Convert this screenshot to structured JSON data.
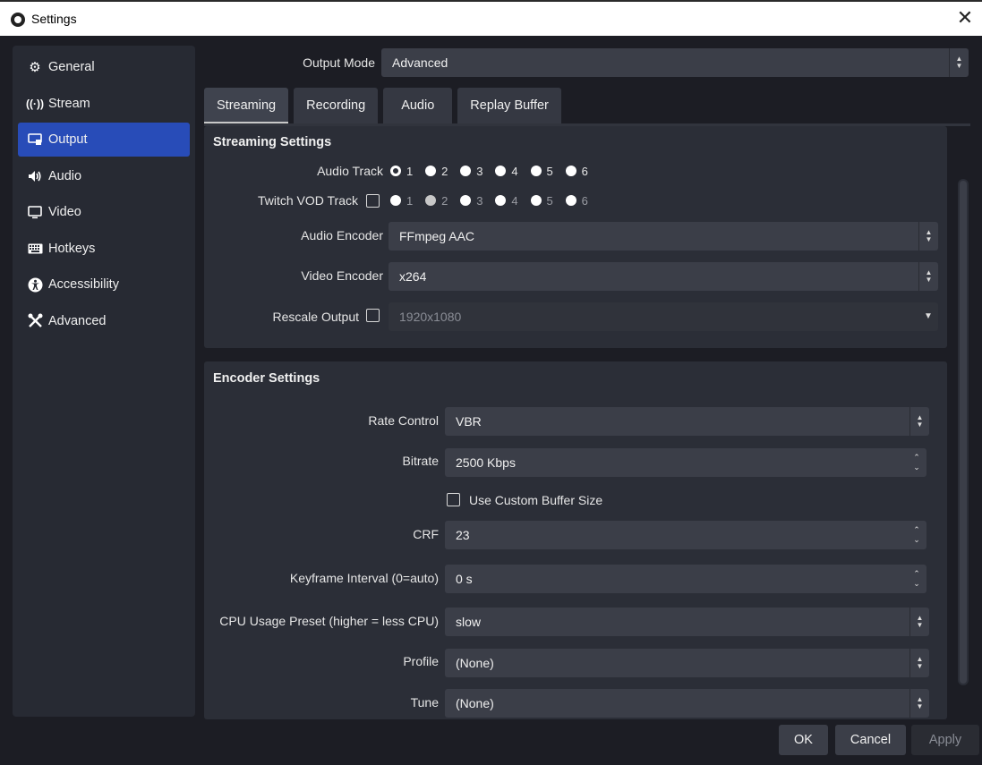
{
  "window": {
    "title": "Settings",
    "close": "✕"
  },
  "sidebar": {
    "items": [
      {
        "label": "General",
        "icon": "gear-icon",
        "glyph": "⚙"
      },
      {
        "label": "Stream",
        "icon": "antenna-icon",
        "glyph": "📶"
      },
      {
        "label": "Output",
        "icon": "output-icon",
        "glyph": "▭"
      },
      {
        "label": "Audio",
        "icon": "speaker-icon",
        "glyph": "🔊"
      },
      {
        "label": "Video",
        "icon": "monitor-icon",
        "glyph": "▢"
      },
      {
        "label": "Hotkeys",
        "icon": "keyboard-icon",
        "glyph": "⌨"
      },
      {
        "label": "Accessibility",
        "icon": "accessibility-icon",
        "glyph": "♿"
      },
      {
        "label": "Advanced",
        "icon": "tools-icon",
        "glyph": "✖"
      }
    ],
    "active": "Output"
  },
  "output_mode": {
    "label": "Output Mode",
    "value": "Advanced"
  },
  "tabs": [
    "Streaming",
    "Recording",
    "Audio",
    "Replay Buffer"
  ],
  "streaming_settings": {
    "title": "Streaming Settings",
    "audio_track_label": "Audio Track",
    "audio_tracks": [
      "1",
      "2",
      "3",
      "4",
      "5",
      "6"
    ],
    "twitch_vod_label": "Twitch VOD Track",
    "twitch_tracks": [
      "1",
      "2",
      "3",
      "4",
      "5",
      "6"
    ],
    "audio_encoder_label": "Audio Encoder",
    "audio_encoder": "FFmpeg AAC",
    "video_encoder_label": "Video Encoder",
    "video_encoder": "x264",
    "rescale_label": "Rescale Output",
    "rescale_value": "1920x1080"
  },
  "encoder_settings": {
    "title": "Encoder Settings",
    "rate_control_label": "Rate Control",
    "rate_control": "VBR",
    "bitrate_label": "Bitrate",
    "bitrate": "2500 Kbps",
    "custom_buffer_label": "Use Custom Buffer Size",
    "crf_label": "CRF",
    "crf": "23",
    "keyframe_label": "Keyframe Interval (0=auto)",
    "keyframe": "0 s",
    "cpu_preset_label": "CPU Usage Preset (higher = less CPU)",
    "cpu_preset": "slow",
    "profile_label": "Profile",
    "profile": "(None)",
    "tune_label": "Tune",
    "tune": "(None)"
  },
  "buttons": {
    "ok": "OK",
    "cancel": "Cancel",
    "apply": "Apply"
  }
}
